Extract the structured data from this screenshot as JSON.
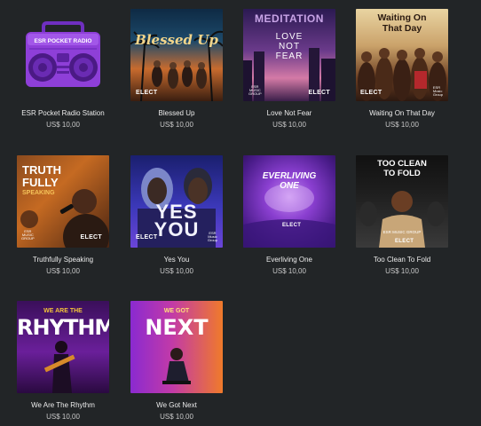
{
  "currency_price": "US$ 10,00",
  "products": [
    {
      "id": "esr-pocket-radio",
      "title": "ESR Pocket Radio Station",
      "price": "US$ 10,00",
      "art_text": "ESR POCKET RADIO"
    },
    {
      "id": "blessed-up",
      "title": "Blessed Up",
      "price": "US$ 10,00",
      "art_text": "Blessed Up",
      "logo": "ELECT"
    },
    {
      "id": "love-not-fear",
      "title": "Love Not Fear",
      "price": "US$ 10,00",
      "art_text_top": "MEDITATION",
      "art_text": [
        "LOVE",
        "NOT",
        "FEAR"
      ],
      "logo": "ELECT",
      "logo_sub": [
        "ESR",
        "MUSIC",
        "GROUP"
      ]
    },
    {
      "id": "waiting-on-that-day",
      "title": "Waiting On That Day",
      "price": "US$ 10,00",
      "art_text": [
        "Waiting On",
        "That Day"
      ],
      "logo": "ELECT",
      "logo_sub": [
        "ESR",
        "Music",
        "Group"
      ]
    },
    {
      "id": "truthfully-speaking",
      "title": "Truthfully Speaking",
      "price": "US$ 10,00",
      "art_text": [
        "TRUTH",
        "FULLY",
        "SPEAKING"
      ],
      "logo": "ELECT",
      "logo_sub": [
        "ESR",
        "MUSIC",
        "GROUP"
      ]
    },
    {
      "id": "yes-you",
      "title": "Yes You",
      "price": "US$ 10,00",
      "art_text": "YES YOU",
      "logo": "ELECT",
      "logo_sub": [
        "ESR",
        "Music",
        "Group"
      ]
    },
    {
      "id": "everliving-one",
      "title": "Everliving One",
      "price": "US$ 10,00",
      "art_text": [
        "EVERLIVING",
        "ONE"
      ],
      "logo": "ELECT"
    },
    {
      "id": "too-clean-to-fold",
      "title": "Too Clean To Fold",
      "price": "US$ 10,00",
      "art_text": [
        "TOO CLEAN",
        "TO FOLD"
      ],
      "art_sub": "ESR MUSIC GROUP",
      "logo": "ELECT"
    },
    {
      "id": "we-are-the-rhythm",
      "title": "We Are The Rhythm",
      "price": "US$ 10,00",
      "art_text": [
        "WE ARE THE",
        "RHYTHM"
      ]
    },
    {
      "id": "we-got-next",
      "title": "We Got Next",
      "price": "US$ 10,00",
      "art_text": [
        "WE GOT",
        "NEXT"
      ]
    }
  ],
  "colors": {
    "background": "#222527",
    "title_text": "#ececec",
    "price_text": "#c9c9c9",
    "radio_purple": "#8e3fd8"
  }
}
